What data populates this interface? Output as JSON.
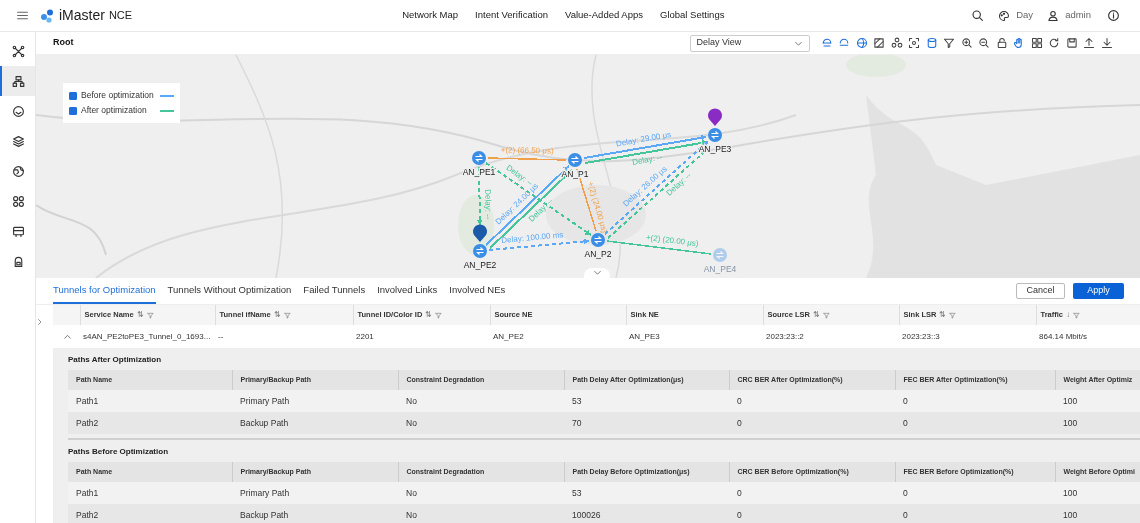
{
  "header": {
    "product": "iMaster",
    "product_suffix": "NCE",
    "nav": [
      "Network Map",
      "Intent Verification",
      "Value-Added Apps",
      "Global Settings"
    ],
    "theme": "Day",
    "user": "admin"
  },
  "sidebar": {
    "items": [
      {
        "selected": false
      },
      {
        "selected": true
      },
      {
        "selected": false
      },
      {
        "selected": false
      },
      {
        "selected": false
      },
      {
        "selected": false
      },
      {
        "selected": false
      },
      {
        "selected": false
      }
    ]
  },
  "breadcrumb": "Root",
  "view_select": {
    "value": "Delay View"
  },
  "legend": [
    {
      "label": "Before optimization",
      "checked": true,
      "color": "#5ba8f7"
    },
    {
      "label": "After optimization",
      "checked": true,
      "color": "#45c59a"
    }
  ],
  "topology": {
    "nodes": [
      {
        "name": "AN_PE1",
        "pin": false,
        "dimmed": false
      },
      {
        "name": "AN_P1",
        "pin": false,
        "dimmed": false
      },
      {
        "name": "AN_PE3",
        "pin": true,
        "color": "#8a2bc4",
        "dimmed": false
      },
      {
        "name": "AN_PE2",
        "pin": true,
        "color": "#1a5aa8",
        "dimmed": false
      },
      {
        "name": "AN_P2",
        "pin": false,
        "dimmed": false
      },
      {
        "name": "AN_PE4",
        "pin": false,
        "dimmed": true
      }
    ],
    "links": [
      {
        "kind": "solid",
        "color": "#5ba8f7",
        "label": "Delay: 24.00 μs"
      },
      {
        "kind": "solid",
        "color": "#5ba8f7",
        "label": "Delay: 29.00 μs"
      },
      {
        "kind": "solid",
        "color": "#45c59a",
        "label": "Delay: --"
      },
      {
        "kind": "solid",
        "color": "#45c59a",
        "label": "Delay: --"
      },
      {
        "kind": "dashed",
        "color": "#5ba8f7",
        "label": "Delay: 100.00 ms"
      },
      {
        "kind": "dashed",
        "color": "#5ba8f7",
        "label": "Delay: 26.00 μs"
      },
      {
        "kind": "dashed",
        "color": "#45c59a",
        "label": "Delay: --"
      },
      {
        "kind": "dashed",
        "color": "#45c59a",
        "label": "Delay: --"
      },
      {
        "kind": "dashed",
        "color": "#45c59a",
        "label": "Delay: --"
      },
      {
        "kind": "thin",
        "color": "#f0a04b",
        "label": "+(2) (66.50 μs)"
      },
      {
        "kind": "thin",
        "color": "#f0a04b",
        "label": "+(2) (24.00 μs)"
      },
      {
        "kind": "thin",
        "color": "#45c59a",
        "label": "+(2) (20.00 μs)"
      }
    ]
  },
  "tabs": [
    {
      "label": "Tunnels for Optimization",
      "selected": true
    },
    {
      "label": "Tunnels Without Optimization",
      "selected": false
    },
    {
      "label": "Failed Tunnels",
      "selected": false
    },
    {
      "label": "Involved Links",
      "selected": false
    },
    {
      "label": "Involved NEs",
      "selected": false
    }
  ],
  "buttons": [
    {
      "label": "Cancel",
      "kind": "secondary"
    },
    {
      "label": "Apply",
      "kind": "primary"
    }
  ],
  "table": {
    "columns": [
      {
        "label": "Service Name",
        "sort": "⇅",
        "filter": true
      },
      {
        "label": "Tunnel ifName",
        "sort": "⇅",
        "filter": true
      },
      {
        "label": "Tunnel ID/Color ID",
        "sort": "⇅",
        "filter": true
      },
      {
        "label": "Source NE",
        "filter": false
      },
      {
        "label": "Sink NE",
        "filter": false
      },
      {
        "label": "Source LSR",
        "sort": "⇅",
        "filter": true
      },
      {
        "label": "Sink LSR",
        "sort": "⇅",
        "filter": true
      },
      {
        "label": "Traffic",
        "sort": "↓",
        "filter": true
      }
    ],
    "rows": [
      {
        "expanded": true,
        "cells": [
          "s4AN_PE2toPE3_Tunnel_0_1693...",
          "--",
          "2201",
          "AN_PE2",
          "AN_PE3",
          "2023:23::2",
          "2023:23::3",
          "864.14 Mbit/s"
        ]
      }
    ]
  },
  "details": [
    {
      "title": "Paths After Optimization",
      "columns": [
        "Path Name",
        "Primary/Backup Path",
        "Constraint Degradation",
        "Path Delay After Optimization(μs)",
        "CRC BER After Optimization(%)",
        "FEC BER After Optimization(%)",
        "Weight After Optimiz"
      ],
      "rows": [
        [
          "Path1",
          "Primary Path",
          "No",
          "53",
          "0",
          "0",
          "100"
        ],
        [
          "Path2",
          "Backup Path",
          "No",
          "70",
          "0",
          "0",
          "100"
        ]
      ]
    },
    {
      "title": "Paths Before Optimization",
      "columns": [
        "Path Name",
        "Primary/Backup Path",
        "Constraint Degradation",
        "Path Delay Before Optimization(μs)",
        "CRC BER Before Optimization(%)",
        "FEC BER Before Optimization(%)",
        "Weight Before Optimi"
      ],
      "rows": [
        [
          "Path1",
          "Primary Path",
          "No",
          "53",
          "0",
          "0",
          "100"
        ],
        [
          "Path2",
          "Backup Path",
          "No",
          "100026",
          "0",
          "0",
          "100"
        ]
      ]
    }
  ]
}
